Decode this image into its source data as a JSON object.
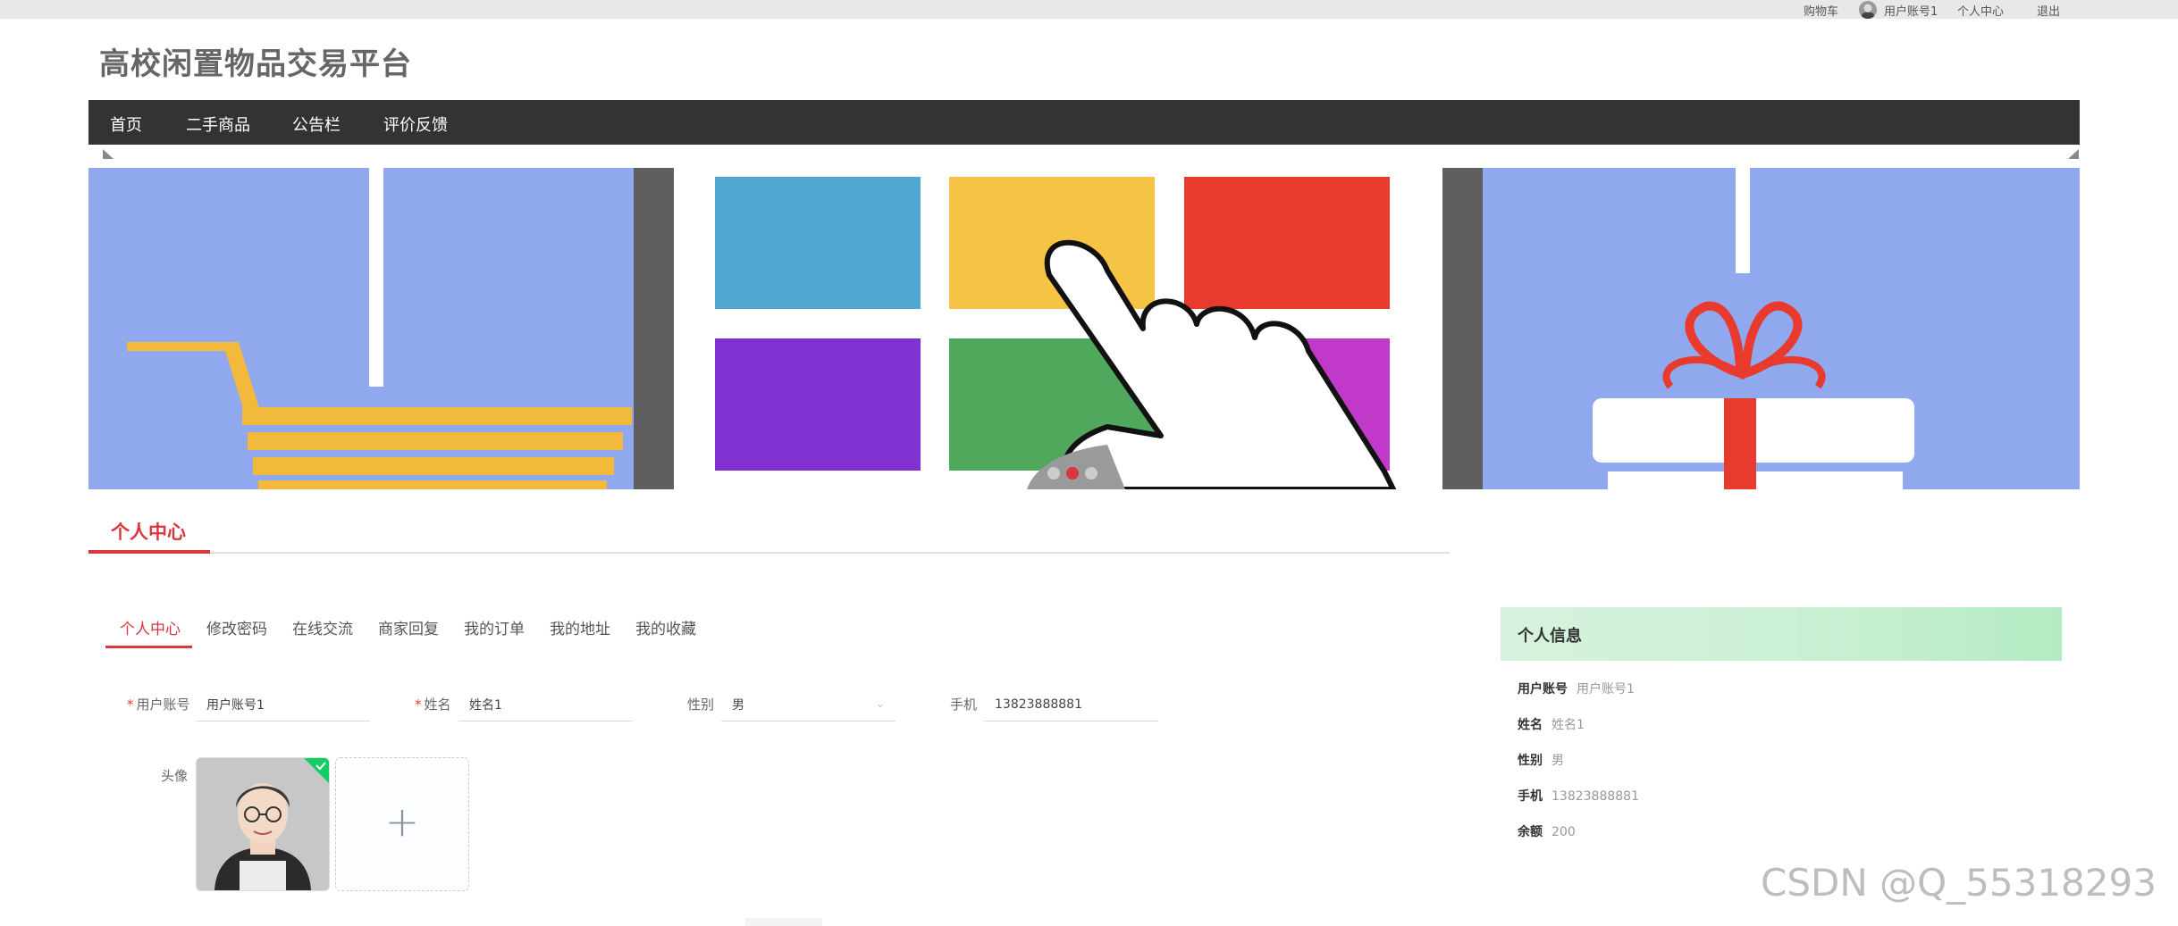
{
  "topbar": {
    "cart": "购物车",
    "username": "用户账号1",
    "center": "个人中心",
    "logout": "退出"
  },
  "site": {
    "title": "高校闲置物品交易平台"
  },
  "nav": {
    "items": [
      {
        "label": "首页"
      },
      {
        "label": "二手商品"
      },
      {
        "label": "公告栏"
      },
      {
        "label": "评价反馈"
      }
    ]
  },
  "banner": {
    "active_slide": 2,
    "slide_count": 3,
    "colors": {
      "bg": "#90a9ee",
      "tile_blue": "#4fa6cf",
      "tile_yellow": "#f5c444",
      "tile_red": "#e83a2d",
      "tile_purple": "#8131cf",
      "tile_green": "#4fa85c",
      "tile_magenta": "#c039c8",
      "cart": "#f2b93b",
      "frame": "#5f5f5f"
    }
  },
  "section": {
    "title": "个人中心"
  },
  "tabs": [
    {
      "label": "个人中心",
      "active": true
    },
    {
      "label": "修改密码",
      "active": false
    },
    {
      "label": "在线交流",
      "active": false
    },
    {
      "label": "商家回复",
      "active": false
    },
    {
      "label": "我的订单",
      "active": false
    },
    {
      "label": "我的地址",
      "active": false
    },
    {
      "label": "我的收藏",
      "active": false
    }
  ],
  "form": {
    "account": {
      "label": "用户账号",
      "value": "用户账号1",
      "required": true
    },
    "name": {
      "label": "姓名",
      "value": "姓名1",
      "required": true
    },
    "gender": {
      "label": "性别",
      "value": "男"
    },
    "phone": {
      "label": "手机",
      "value": "13823888881"
    },
    "avatar": {
      "label": "头像"
    }
  },
  "info_panel": {
    "title": "个人信息",
    "rows": [
      {
        "key": "用户账号",
        "value": "用户账号1"
      },
      {
        "key": "姓名",
        "value": "姓名1"
      },
      {
        "key": "性别",
        "value": "男"
      },
      {
        "key": "手机",
        "value": "13823888881"
      },
      {
        "key": "余额",
        "value": "200"
      }
    ]
  },
  "watermark": "CSDN @Q_55318293",
  "colors": {
    "accent": "#d9363e",
    "nav_bg": "#333333",
    "info_head": "#c9f0d2",
    "upload_ok": "#13ce66"
  }
}
